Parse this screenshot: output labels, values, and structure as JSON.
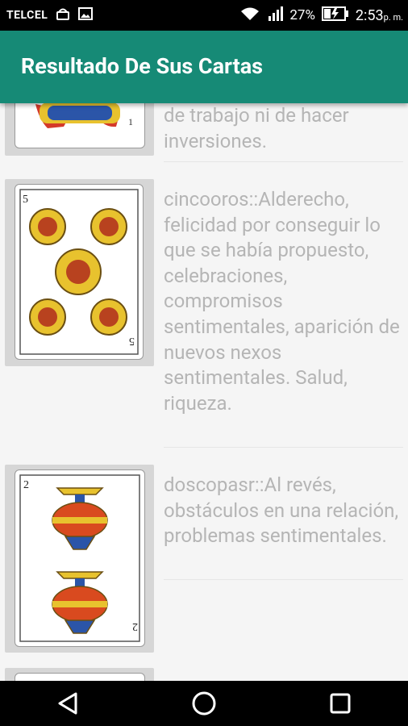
{
  "status_bar": {
    "carrier": "TELCEL",
    "battery": "27%",
    "time": "2:53",
    "time_suffix": "p. m."
  },
  "app_bar": {
    "title": "Resultado De Sus Cartas"
  },
  "results": [
    {
      "card": "as de oros",
      "text": "de trabajo ni de hacer inversiones."
    },
    {
      "card": "cinco de oros",
      "text": "cincooros::Alderecho, felicidad por conseguir lo que se había propuesto, celebraciones, compromisos sentimentales, aparición de nuevos nexos sentimentales. Salud, riqueza."
    },
    {
      "card": "dos de copas",
      "text": "doscopasr::Al revés, obstáculos en una relación, problemas sentimentales."
    }
  ],
  "nav": [
    "back-icon",
    "home-icon",
    "recents-icon"
  ]
}
